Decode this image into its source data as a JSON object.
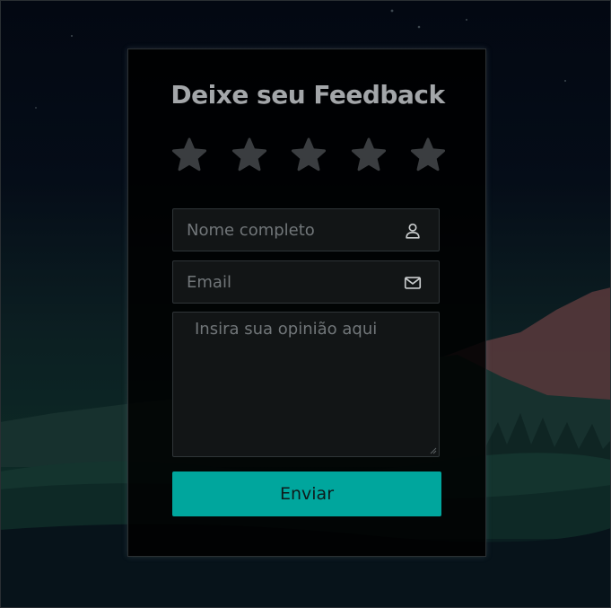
{
  "feedback": {
    "title": "Deixe seu Feedback",
    "stars": [
      "star-icon",
      "star-icon",
      "star-icon",
      "star-icon",
      "star-icon"
    ],
    "star_color": "#3a3d40",
    "name_field": {
      "placeholder": "Nome completo",
      "value": "",
      "icon": "user-icon"
    },
    "email_field": {
      "placeholder": "Email",
      "value": "",
      "icon": "envelope-icon"
    },
    "message_field": {
      "placeholder": "Insira sua opinião aqui",
      "value": ""
    },
    "submit_label": "Enviar",
    "accent_color": "#00a69d"
  }
}
